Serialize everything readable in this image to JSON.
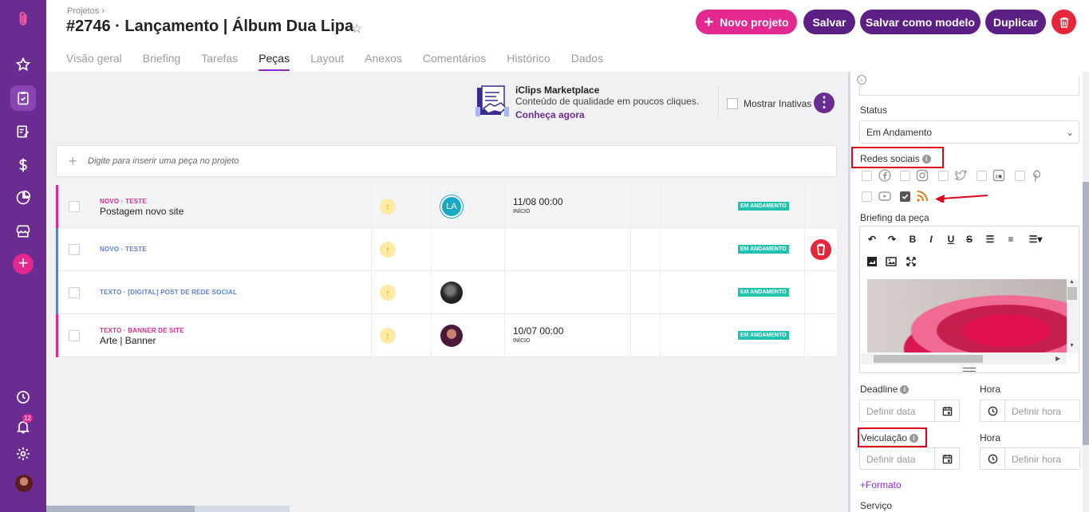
{
  "sidebar": {
    "icons": [
      "clip-logo-icon",
      "star-icon",
      "clipboard-icon",
      "edit-icon",
      "dollar-icon",
      "pie-chart-icon",
      "store-icon",
      "plus-icon",
      "clock-icon",
      "bell-icon",
      "gear-icon",
      "avatar"
    ],
    "notifications_badge": "12",
    "plus_label": "+"
  },
  "header": {
    "breadcrumb": "Projetos",
    "breadcrumb_sep": "›",
    "title": "#2746 · Lançamento | Álbum Dua Lipa",
    "star": "☆",
    "buttons": {
      "new_project": "Novo projeto",
      "new_project_icon": "+",
      "save": "Salvar",
      "save_template": "Salvar como modelo",
      "duplicate": "Duplicar"
    },
    "colors": {
      "pink": "#e3288f",
      "purple": "#5c1f86",
      "red": "#e5263b"
    }
  },
  "tabs": [
    {
      "label": "Visão geral"
    },
    {
      "label": "Briefing"
    },
    {
      "label": "Tarefas"
    },
    {
      "label": "Peças",
      "active": true
    },
    {
      "label": "Layout"
    },
    {
      "label": "Anexos"
    },
    {
      "label": "Comentários"
    },
    {
      "label": "Histórico"
    },
    {
      "label": "Dados"
    }
  ],
  "marketplace": {
    "title": "iClips Marketplace",
    "subtitle": "Conteúdo de qualidade em poucos cliques.",
    "link": "Conheça agora"
  },
  "show_inactive_label": "Mostrar Inativas",
  "more_label": "⋮",
  "add_piece_placeholder": "Digite para inserir uma peça no projeto",
  "add_piece_icon": "+",
  "pieces": [
    {
      "type": "Novo",
      "category": "Teste",
      "name": "Postagem novo site",
      "priority": "↑",
      "avatar_initials": "LA",
      "date": "11/08 00:00",
      "date_label": "INÍCIO",
      "status": "EM ANDAMENTO",
      "bar_color": "#e3288f",
      "meta_color": "#e3288f"
    },
    {
      "type": "Novo",
      "category": "Teste",
      "name": "",
      "priority": "↑",
      "avatar_initials": "",
      "date": "",
      "date_label": "",
      "status": "EM ANDAMENTO",
      "bar_color": "#5b7fd0",
      "meta_color": "#5b7fd0"
    },
    {
      "type": "Texto",
      "category": "[Digital] Post de rede social",
      "name": "",
      "priority": "↑",
      "avatar_initials": "",
      "date": "",
      "date_label": "",
      "status": "EM ANDAMENTO",
      "bar_color": "#5b7fd0",
      "meta_color": "#5b7fd0"
    },
    {
      "type": "Texto",
      "category": "Banner de site",
      "name": "Arte | Banner",
      "priority": "↑",
      "avatar_initials": "",
      "date": "10/07 00:00",
      "date_label": "INÍCIO",
      "status": "EM ANDAMENTO",
      "bar_color": "#e3288f",
      "meta_color": "#e3288f"
    }
  ],
  "meta_separator": "·",
  "panel": {
    "status_label": "Status",
    "status_value": "Em Andamento",
    "social_label": "Redes sociais",
    "social_networks": [
      {
        "icon": "facebook-icon",
        "checked": false
      },
      {
        "icon": "instagram-icon",
        "checked": false
      },
      {
        "icon": "twitter-icon",
        "checked": false
      },
      {
        "icon": "linkedin-icon",
        "checked": false
      },
      {
        "icon": "pinterest-icon",
        "checked": false
      },
      {
        "icon": "youtube-icon",
        "checked": false
      },
      {
        "icon": "rss-icon",
        "checked": true
      }
    ],
    "briefing_label": "Briefing da peça",
    "toolbar": [
      "↶",
      "↷",
      "B",
      "I",
      "U",
      "S",
      "☰",
      "≡",
      "☰▾"
    ],
    "deadline_label": "Deadline",
    "hour_label": "Hora",
    "date_placeholder": "Definir data",
    "hour_placeholder": "Definir hora",
    "veiculacao_label": "Veiculação",
    "format_link": "+Formato",
    "service_label": "Serviço",
    "info_glyph": "i"
  }
}
